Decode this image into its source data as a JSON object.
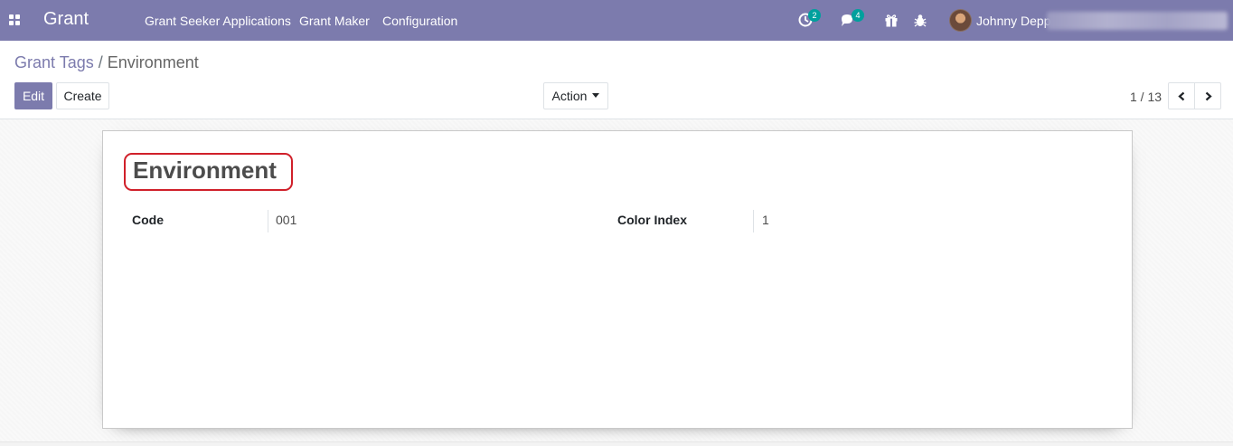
{
  "navbar": {
    "app_name": "Grant",
    "menu": [
      "Grant Seeker Applications",
      "Grant Maker",
      "Configuration"
    ],
    "activity_count": "2",
    "message_count": "4",
    "user_name": "Johnny Depp",
    "color": "#7c7bad",
    "icons": [
      "apps-icon",
      "activity-clock-icon",
      "chat-bubbles-icon",
      "gift-icon",
      "bug-icon"
    ]
  },
  "breadcrumb": {
    "parent": "Grant Tags",
    "separator": "/",
    "current": "Environment"
  },
  "buttons": {
    "edit": "Edit",
    "create": "Create",
    "action": "Action"
  },
  "pager": {
    "value": "1 / 13"
  },
  "record": {
    "name": "Environment",
    "fields": {
      "code_label": "Code",
      "code_value": "001",
      "color_index_label": "Color Index",
      "color_index_value": "1"
    }
  },
  "highlight_color": "#d0202a"
}
